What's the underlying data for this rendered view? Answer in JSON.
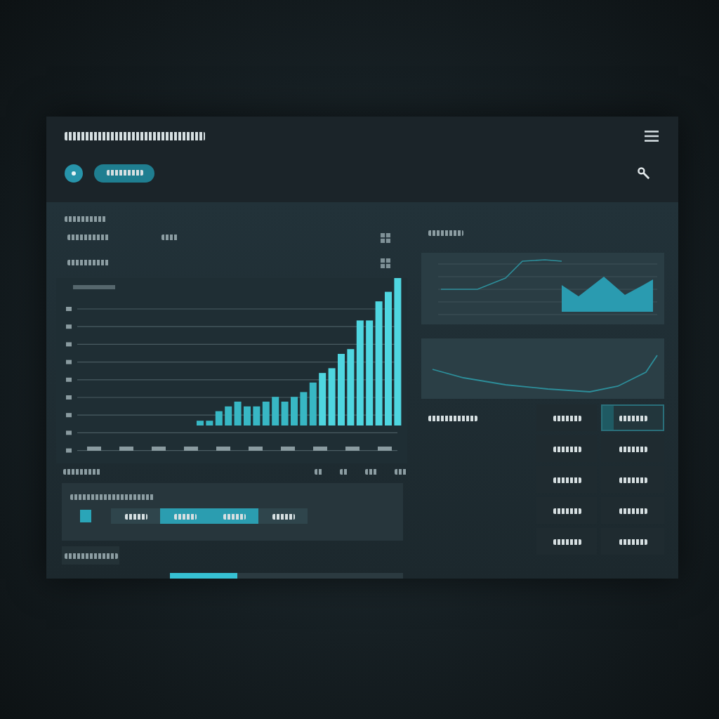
{
  "header": {
    "buttons": [
      {
        "kind": "round"
      },
      {
        "kind": "pill"
      }
    ]
  },
  "filters": [
    {
      "kind": "grid"
    },
    {
      "kind": "grid"
    }
  ],
  "charts": [
    {
      "kind": "bar"
    },
    {
      "kind": "area"
    },
    {
      "kind": "line"
    }
  ],
  "segments": [
    {
      "selected": true
    },
    {
      "selected": false
    },
    {
      "selected": true
    },
    {
      "selected": true
    },
    {
      "selected": false
    }
  ],
  "tiles": [
    {
      "selected": false
    },
    {
      "selected": true
    },
    {
      "selected": false
    },
    {
      "selected": false
    },
    {
      "selected": false
    },
    {
      "selected": false
    },
    {
      "selected": false
    },
    {
      "selected": false
    },
    {
      "selected": false
    },
    {
      "selected": false
    }
  ],
  "progress": {
    "level": 0.29
  }
}
